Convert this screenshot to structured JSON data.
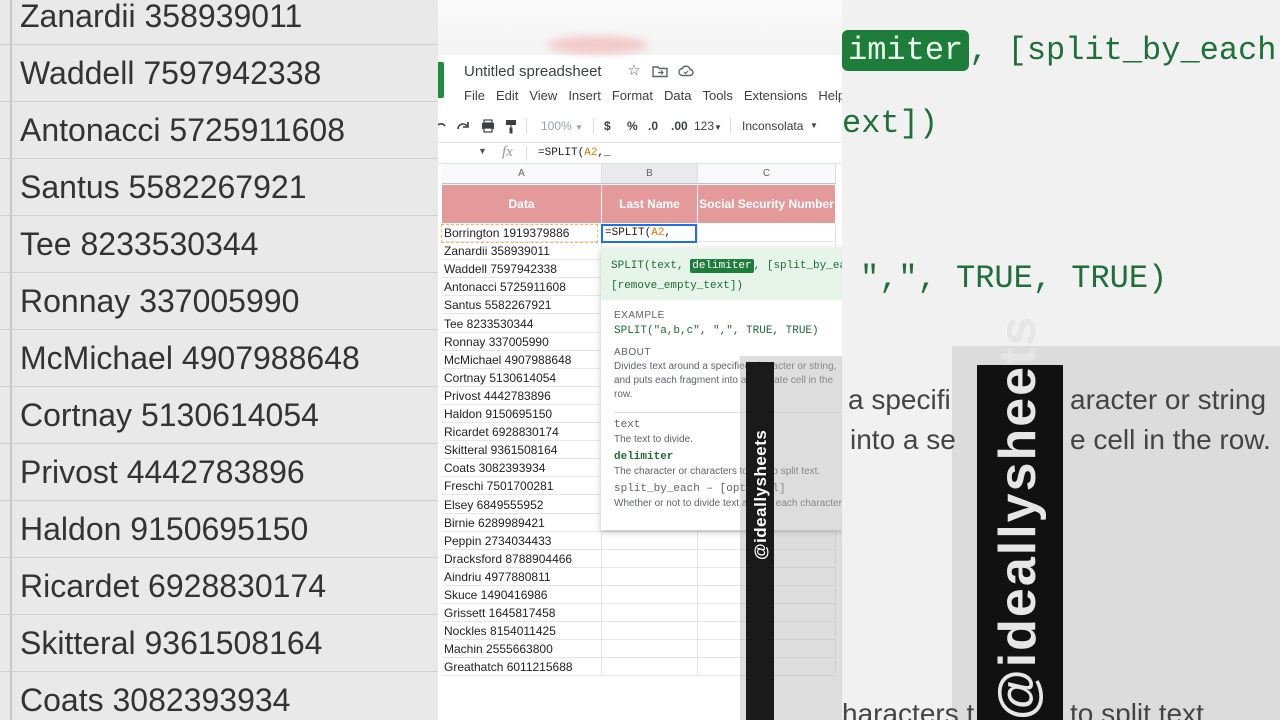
{
  "background_left": {
    "rows": [
      "Zanardii 358939011",
      "Waddell 7597942338",
      "Antonacci 5725911608",
      "Santus 5582267921",
      "Tee 8233530344",
      "Ronnay 337005990",
      "McMichael 4907988648",
      "Cortnay 5130614054",
      "Privost 4442783896",
      "Haldon 9150695150",
      "Ricardet 6928830174",
      "Skitteral 9361508164",
      "Coats 3082393934"
    ]
  },
  "background_right": {
    "line1_hl": "imiter",
    "line1_rest": ", [split_by_each",
    "line2": "ext])",
    "line3": "\",\", TRUE, TRUE)",
    "about1": "a specifi",
    "about1b": "aracter or string",
    "about2": "into a se",
    "about2b": "e cell in the row.",
    "bottom": "haracters t",
    "bottom2": "to split text.",
    "watermark": "@ideallysheets"
  },
  "app": {
    "title": "Untitled spreadsheet",
    "menu": [
      "File",
      "Edit",
      "View",
      "Insert",
      "Format",
      "Data",
      "Tools",
      "Extensions",
      "Help"
    ],
    "toolbar": {
      "zoom": "100%",
      "currency": "$",
      "percent": "%",
      "dec_decrease": ".0",
      "dec_increase": ".00",
      "format_more": "123",
      "font": "Inconsolata"
    },
    "formula_bar": {
      "fx": "fx",
      "formula_prefix": "=SPLIT(",
      "formula_ref": "A2",
      "formula_suffix": ",_"
    }
  },
  "sheet": {
    "columns": [
      "A",
      "B",
      "C"
    ],
    "headers": [
      "Data",
      "Last Name",
      "Social Security Number"
    ],
    "header_color": "#e49a9a",
    "active_cell": {
      "prefix": "=SPLIT(",
      "ref": "A2",
      "suffix": ","
    },
    "rows": [
      "Borrington 1919379886",
      "Zanardii 358939011",
      "Waddell 7597942338",
      "Antonacci 5725911608",
      "Santus 5582267921",
      "Tee 8233530344",
      "Ronnay 337005990",
      "McMichael 4907988648",
      "Cortnay 5130614054",
      "Privost 4442783896",
      "Haldon 9150695150",
      "Ricardet 6928830174",
      "Skitteral 9361508164",
      "Coats 3082393934",
      "Freschi 7501700281",
      "Elsey 6849555952",
      "Birnie 6289989421",
      "Peppin 2734034433",
      "Dracksford 8788904466",
      "Aindriu 4977880811",
      "Skuce 1490416986",
      "Grissett 1645817458",
      "Nockles 8154011425",
      "Machin 2555663800",
      "Greathatch 6011215688"
    ]
  },
  "help_popup": {
    "sig_start": "SPLIT(text, ",
    "sig_hl": "delimiter",
    "sig_end": ", [split_by_each]",
    "sig_line2": "[remove_empty_text])",
    "example_label": "EXAMPLE",
    "example": "SPLIT(\"a,b,c\", \",\", TRUE, TRUE)",
    "about_label": "ABOUT",
    "about": "Divides text around a specified character or string, and puts each fragment into a separate cell in the row.",
    "args": [
      {
        "name": "text",
        "desc": "The text to divide."
      },
      {
        "name": "delimiter",
        "desc": "The character or characters to use to split text."
      },
      {
        "name": "split_by_each – [optional]",
        "desc": "Whether or not to divide text around each character"
      }
    ]
  },
  "watermark": "@ideallysheets"
}
